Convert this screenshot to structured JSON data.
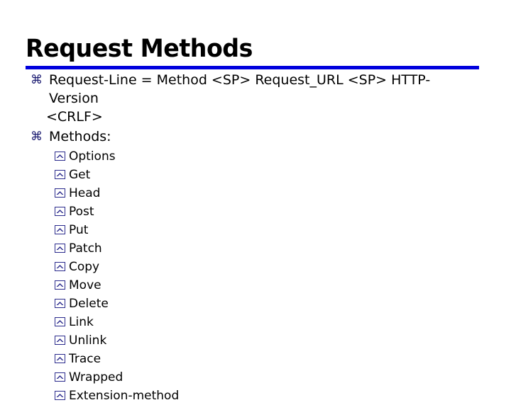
{
  "slide": {
    "title": "Request Methods",
    "rule_color": "#0000dd",
    "text_color": "#000000",
    "bullet1_color": "#191970",
    "bullet2_color": "#2a2a8c",
    "bullet1_glyph": "⌘",
    "bullet1_icon_name": "place-of-interest-bullet-icon",
    "bullet2_icon_name": "boxed-caret-bullet-icon",
    "level1": [
      {
        "text": "Request-Line = Method <SP> Request_URL <SP> HTTP-Version",
        "continuation": "<CRLF>"
      },
      {
        "text": "Methods:",
        "continuation": ""
      }
    ],
    "methods": [
      "Options",
      "Get",
      "Head",
      "Post",
      "Put",
      "Patch",
      "Copy",
      "Move",
      "Delete",
      "Link",
      "Unlink",
      "Trace",
      "Wrapped",
      "Extension-method"
    ]
  }
}
